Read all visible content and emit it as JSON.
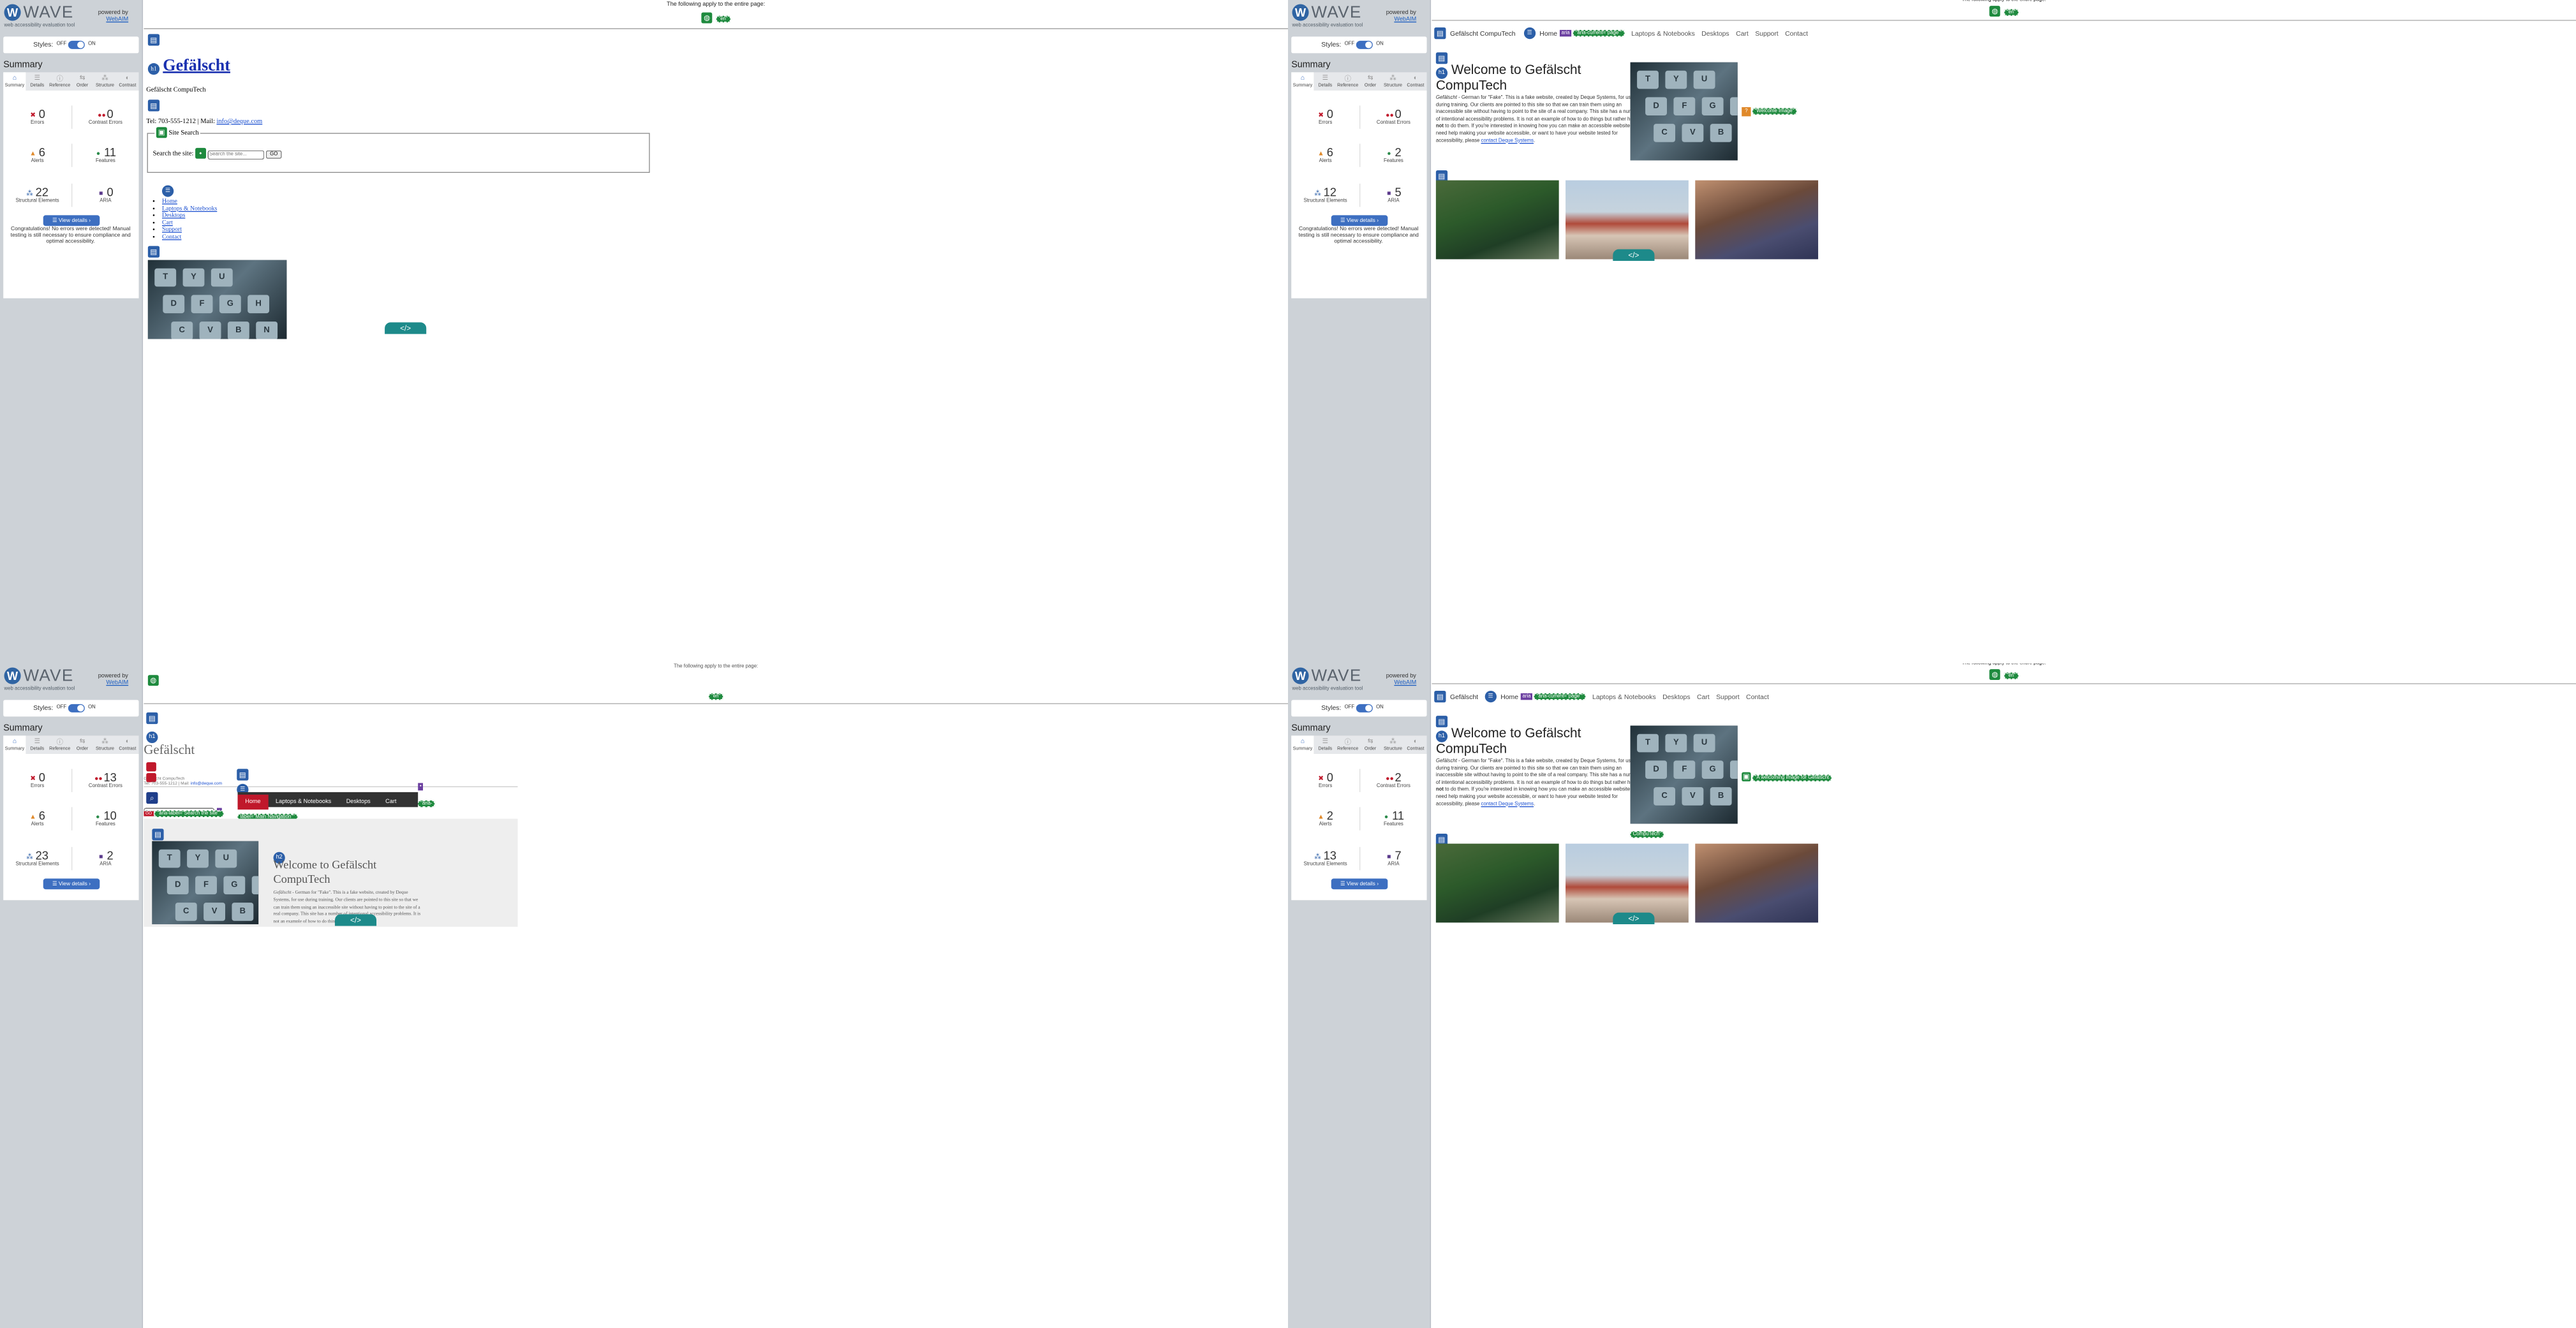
{
  "wave": {
    "logo_word": "WAVE",
    "logo_letter": "W",
    "subtitle": "web accessibility evaluation tool",
    "powered_by": "powered by",
    "webaim": "WebAIM",
    "styles_label": "Styles:",
    "off": "OFF",
    "on": "ON",
    "summary_title": "Summary",
    "view_details": "View details ›",
    "congrats": "Congratulations! No errors were detected! Manual testing is still necessary to ensure compliance and optimal accessibility."
  },
  "tabs": [
    "Summary",
    "Details",
    "Reference",
    "Order",
    "Structure",
    "Contrast"
  ],
  "stat_labels": {
    "errors": "Errors",
    "contrast": "Contrast Errors",
    "alerts": "Alerts",
    "features": "Features",
    "structural": "Structural Elements",
    "aria": "ARIA"
  },
  "panels": [
    {
      "errors": "0",
      "contrast": "0",
      "alerts": "6",
      "features": "11",
      "structural": "22",
      "aria": "0"
    },
    {
      "errors": "0",
      "contrast": "0",
      "alerts": "6",
      "features": "2",
      "structural": "12",
      "aria": "5"
    },
    {
      "errors": "0",
      "contrast": "13",
      "alerts": "6",
      "features": "10",
      "structural": "23",
      "aria": "2"
    },
    {
      "errors": "0",
      "contrast": "2",
      "alerts": "2",
      "features": "11",
      "structural": "13",
      "aria": "7"
    }
  ],
  "page": {
    "applies": "The following apply to the entire page:",
    "lang": "\"en\"",
    "short_brand": "Gefälscht",
    "brand": "Gefälscht CompuTech",
    "contact_line": "Tel: 703-555-1212 | Mail:",
    "email": "info@deque.com",
    "site_search": "Site Search",
    "search_label": "Search the site:",
    "search_placeholder": "Search the site...",
    "go": "GO",
    "welcome": "Welcome to Gefälscht CompuTech",
    "intro_em": "Gefälscht",
    "intro_1": " - German for \"Fake\". This is a fake website, created by Deque Systems, for use during training. Our clients are pointed to this site so that we can train them using an inaccessible site without having to point to the site of a real company. This site has a number of intentional accessibility problems. It is not an example of how to do things but rather how ",
    "intro_not": "not",
    "intro_2": " to do them. If you're interested in knowing how you can make an accessible website, need help making your website accessible, or want to have your website tested for accessibility, please ",
    "contact_link": "contact Deque Systems",
    "period": ".",
    "h1": "h1",
    "h2": "h2",
    "aria_current": "\"aria-current=\"page\"\"",
    "aria_search": "\"aria-label=\"Search the site\"\"",
    "aria_nav_1": "\"aria-",
    "aria_nav_2": "label=\"Main Navigation\"\"",
    "alt1": "\"Welcome Image\"",
    "alt2": "\"A welcoming image for Gefälscht",
    "alt2b": "CompuTech\"",
    "aria": "aria",
    "code": "</>",
    "question": "?"
  },
  "nav": [
    "Home",
    "Laptops & Notebooks",
    "Desktops",
    "Cart",
    "Support",
    "Contact"
  ],
  "keys": [
    "T",
    "Y",
    "U",
    "D",
    "F",
    "G",
    "H",
    "C",
    "V",
    "B",
    "N"
  ]
}
